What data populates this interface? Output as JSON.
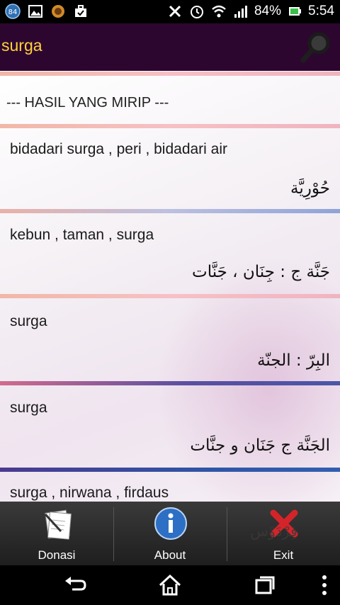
{
  "status_bar": {
    "notification_badge": "84",
    "battery_percent": "84%",
    "time": "5:54",
    "icons": [
      "notification-badge-icon",
      "gallery-icon",
      "app-ring-icon",
      "briefcase-icon",
      "nfc-icon",
      "alarm-icon",
      "wifi-icon",
      "signal-icon",
      "battery-icon"
    ]
  },
  "action_bar": {
    "title": "surga",
    "search_icon": "search-icon"
  },
  "results": {
    "header": "--- HASIL YANG MIRIP ---",
    "items": [
      {
        "indonesian": "bidadari surga ,  peri ,  bidadari air",
        "arabic": "حُوْرِيَّة"
      },
      {
        "indonesian": "kebun ,  taman ,  surga",
        "arabic": "جَنَّة ج : جِنَان ، جَنَّات"
      },
      {
        "indonesian": "surga",
        "arabic": "البِرّ : الجنّة"
      },
      {
        "indonesian": "surga",
        "arabic": "الجَنَّة ج جَنَان و جنَّات"
      },
      {
        "indonesian": "surga ,  nirwana ,  firdaus",
        "arabic": "فِرْدَوْس"
      }
    ]
  },
  "bottom_bar": {
    "donasi": "Donasi",
    "about": "About",
    "exit": "Exit"
  },
  "colors": {
    "action_bar_bg": "#2d0630",
    "title_color": "#ffd23a"
  }
}
